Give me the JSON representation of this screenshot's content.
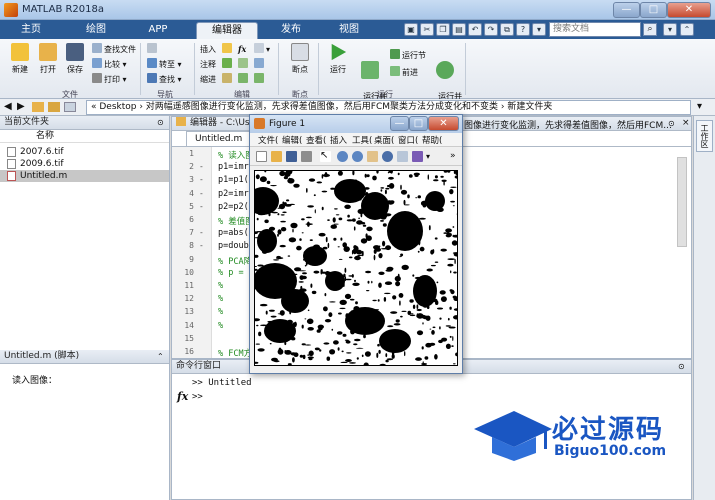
{
  "window": {
    "title": "MATLAB R2018a",
    "min_label": "—",
    "max_label": "□",
    "close_label": "✕"
  },
  "ribbon_tabs": [
    "主页",
    "绘图",
    "APP",
    "编辑器",
    "发布",
    "视图"
  ],
  "search": {
    "placeholder": "搜索文档"
  },
  "ribbon": {
    "file_group": {
      "label": "文件",
      "new": "新建",
      "open": "打开",
      "save": "保存",
      "find_files": "查找文件",
      "compare": "比较",
      "print": "打印"
    },
    "nav_group": {
      "label": "导航",
      "goto": "转至",
      "find": "查找"
    },
    "edit_group": {
      "label": "编辑",
      "insert": "插入",
      "comment": "注释",
      "indent": "缩进",
      "fx": "fx"
    },
    "breakpoint_group": {
      "label": "断点",
      "breakpoints": "断点"
    },
    "run_group": {
      "label": "运行",
      "run": "运行",
      "run_advance": "运行并\n前进",
      "run_section": "运行节",
      "advance": "前进",
      "run_time": "运行并\n计时"
    }
  },
  "address": {
    "path": "« Desktop › 对两幅遥感图像进行变化监测，先求得差值图像，然后用FCM聚类方法分成变化和不变类 › 新建文件夹"
  },
  "current_folder": {
    "title": "当前文件夹",
    "column_name": "名称",
    "files": [
      {
        "name": "2007.6.tif",
        "selected": false
      },
      {
        "name": "2009.6.tif",
        "selected": false
      },
      {
        "name": "Untitled.m",
        "selected": true
      }
    ]
  },
  "details": {
    "title": "Untitled.m  (脚本)",
    "content": "读入图像："
  },
  "editor": {
    "header": "编辑器 - C:\\Use",
    "header_right": "图像进行变化监测，先求得差值图像，然后用FCM...",
    "tab": "Untitled.m",
    "lines": [
      {
        "n": "1",
        "dash": "",
        "text": "% 读入图",
        "comment": true
      },
      {
        "n": "2",
        "dash": "-",
        "text": "p1=imre",
        "comment": false
      },
      {
        "n": "3",
        "dash": "-",
        "text": "p1=p1(2",
        "comment": false
      },
      {
        "n": "4",
        "dash": "-",
        "text": "p2=imre",
        "comment": false
      },
      {
        "n": "5",
        "dash": "-",
        "text": "p2=p2(2",
        "comment": false
      },
      {
        "n": "6",
        "dash": "",
        "text": "% 差值图",
        "comment": true
      },
      {
        "n": "7",
        "dash": "-",
        "text": "p=abs(p",
        "comment": false
      },
      {
        "n": "8",
        "dash": "-",
        "text": "p=doubl",
        "comment": false
      },
      {
        "n": "9",
        "dash": "",
        "text": "% PCA降",
        "comment": true
      },
      {
        "n": "10",
        "dash": "",
        "text": "% p = ",
        "comment": true
      },
      {
        "n": "11",
        "dash": "",
        "text": "%",
        "comment": true
      },
      {
        "n": "12",
        "dash": "",
        "text": "%",
        "comment": true
      },
      {
        "n": "13",
        "dash": "",
        "text": "%",
        "comment": true
      },
      {
        "n": "14",
        "dash": "",
        "text": "%",
        "comment": true
      },
      {
        "n": "15",
        "dash": "",
        "text": "",
        "comment": true
      },
      {
        "n": "16",
        "dash": "",
        "text": "% FCM方",
        "comment": true
      }
    ]
  },
  "figure": {
    "title": "Figure 1",
    "menu": [
      "文件(",
      "编辑(",
      "查看(",
      "插入",
      "工具(",
      "桌面(",
      "窗口(",
      "帮助("
    ]
  },
  "command_window": {
    "title": "命令行窗口",
    "line1": ">> Untitled",
    "prompt": ">>",
    "fx": "fx"
  },
  "workspace": {
    "label": "工作区"
  },
  "watermark": {
    "big": "必过源码",
    "small": "Biguo100.com"
  }
}
